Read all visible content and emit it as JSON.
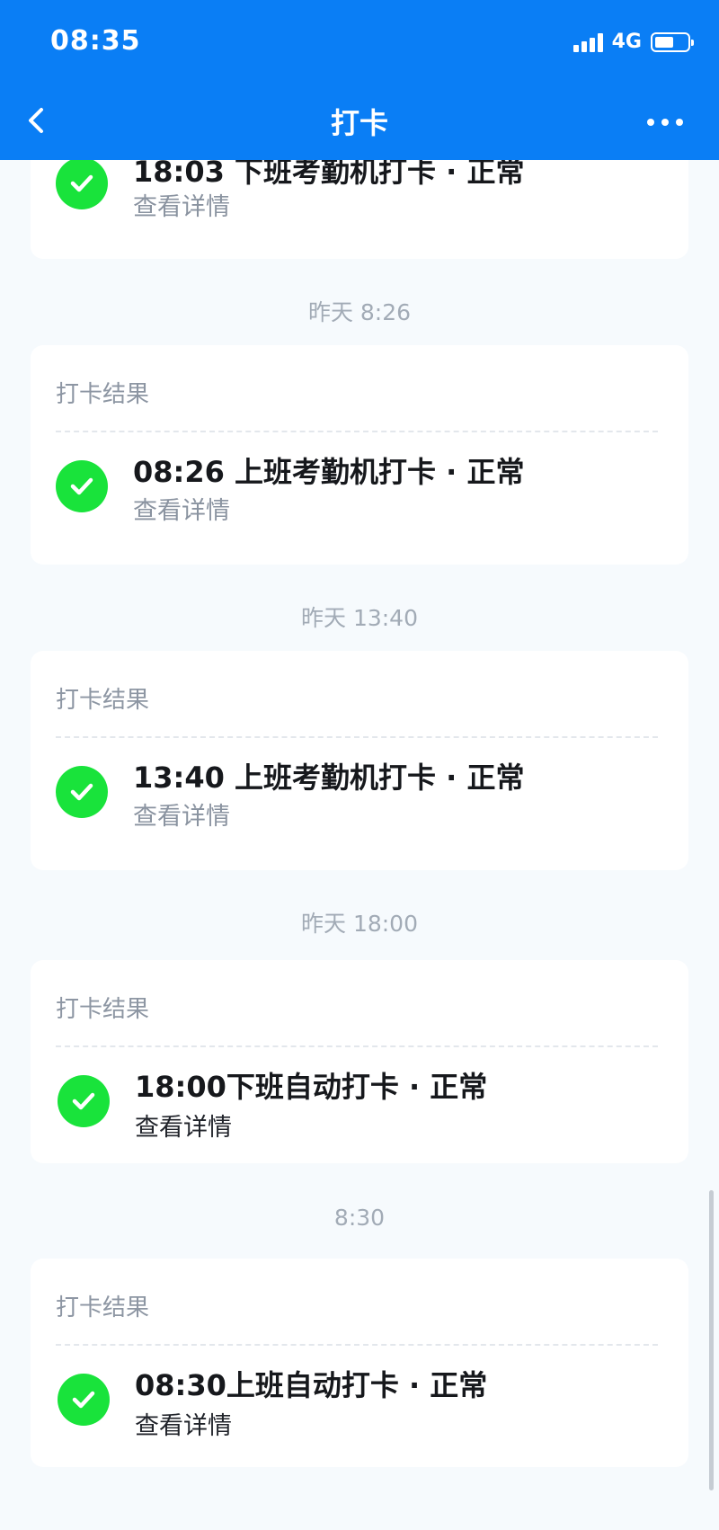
{
  "status_bar": {
    "time": "08:35",
    "network": "4G"
  },
  "nav": {
    "title": "打卡"
  },
  "top_partial": {
    "title": "18:03 下班考勤机打卡 · 正常",
    "link": "查看详情"
  },
  "groups": [
    {
      "timestamp": "昨天 8:26",
      "header": "打卡结果",
      "title": "08:26 上班考勤机打卡 · 正常",
      "link": "查看详情"
    },
    {
      "timestamp": "昨天 13:40",
      "header": "打卡结果",
      "title": "13:40 上班考勤机打卡 · 正常",
      "link": "查看详情"
    },
    {
      "timestamp": "昨天 18:00",
      "header": "打卡结果",
      "title": "18:00下班自动打卡 · 正常",
      "link": "查看详情"
    },
    {
      "timestamp": "8:30",
      "header": "打卡结果",
      "title": "08:30上班自动打卡 · 正常",
      "link": "查看详情"
    }
  ]
}
